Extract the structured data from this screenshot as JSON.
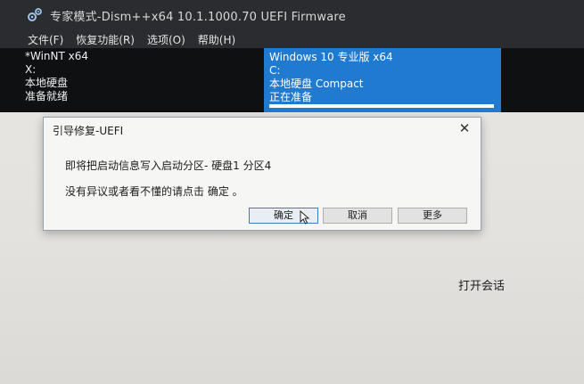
{
  "window": {
    "title": "专家模式-Dism++x64 10.1.1000.70 UEFI Firmware",
    "icon": "gears-icon"
  },
  "menu": [
    {
      "label": "文件(F)"
    },
    {
      "label": "恢复功能(R)"
    },
    {
      "label": "选项(O)"
    },
    {
      "label": "帮助(H)"
    }
  ],
  "sessions": {
    "left": {
      "name": "*WinNT x64",
      "drive": "X:",
      "disk": "本地硬盘",
      "status": "准备就绪"
    },
    "right": {
      "name": "Windows 10 专业版 x64",
      "drive": "C:",
      "disk": "本地硬盘 Compact",
      "status": "正在准备",
      "progress": 1.0,
      "accent": "#1f7ad0"
    }
  },
  "dialog": {
    "title": "引导修复-UEFI",
    "message1": "即将把启动信息写入启动分区- 硬盘1 分区4",
    "message2": "没有异议或者看不懂的请点击 确定 。",
    "buttons": {
      "ok": "确定",
      "cancel": "取消",
      "more": "更多"
    },
    "close_icon": "close-icon"
  },
  "main": {
    "open_session": "打开会话"
  }
}
